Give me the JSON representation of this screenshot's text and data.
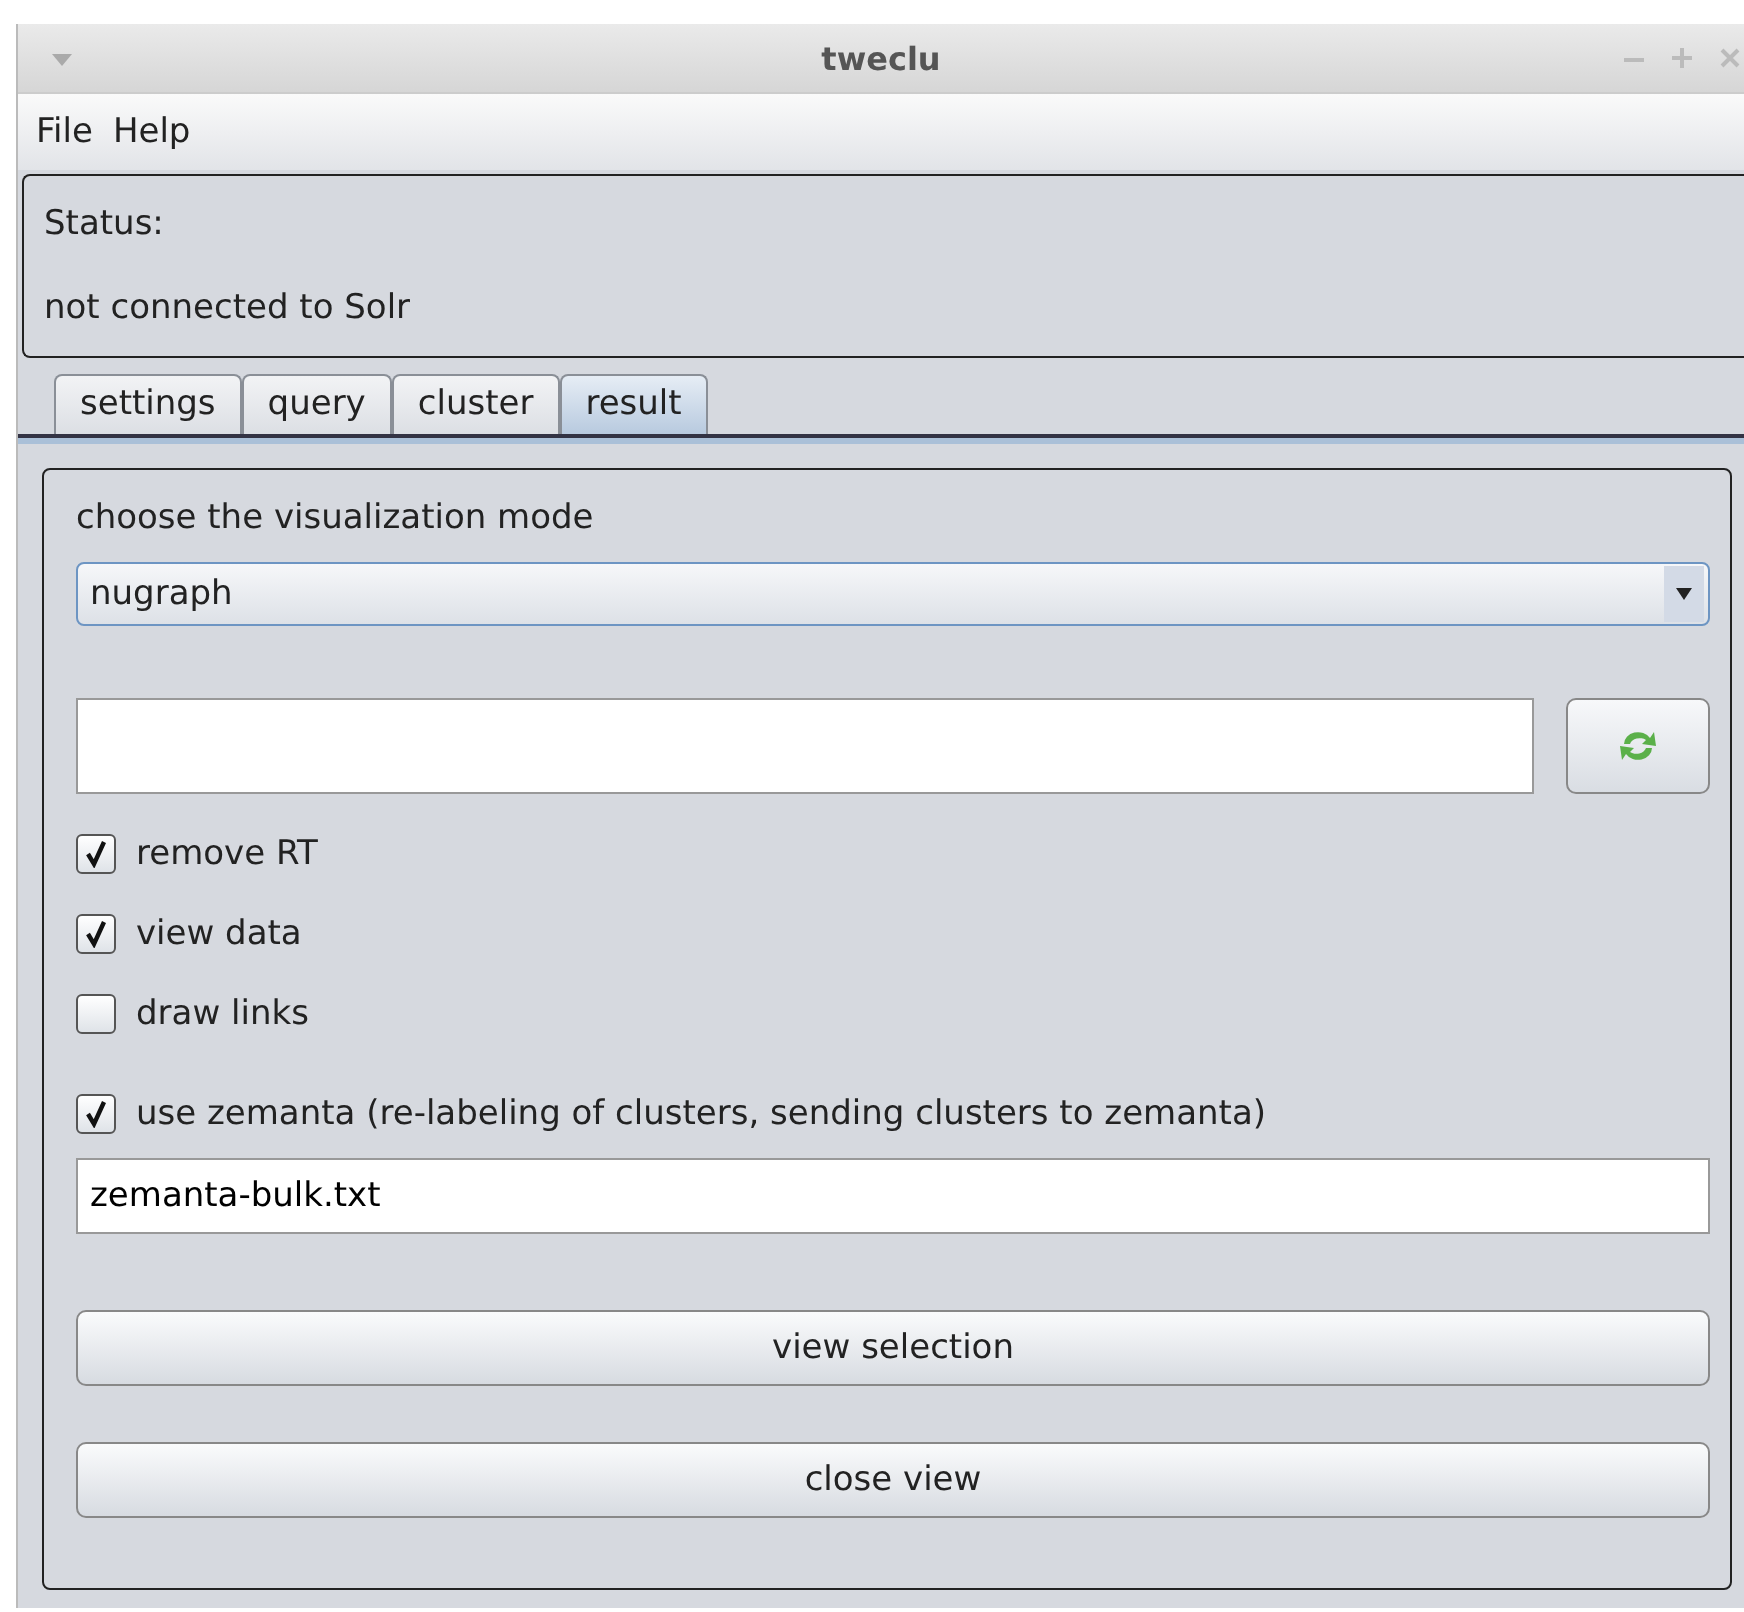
{
  "window": {
    "title": "tweclu"
  },
  "menu": [
    "File",
    "Help"
  ],
  "status": {
    "label": "Status:",
    "message": "not connected to Solr"
  },
  "tabs": [
    {
      "label": "settings",
      "selected": false
    },
    {
      "label": "query",
      "selected": false
    },
    {
      "label": "cluster",
      "selected": false
    },
    {
      "label": "result",
      "selected": true
    }
  ],
  "result": {
    "mode_label": "choose the visualization mode",
    "mode": "nugraph",
    "options": [
      {
        "label": "remove RT",
        "checked": true
      },
      {
        "label": "view data",
        "checked": true
      },
      {
        "label": "draw links",
        "checked": false
      }
    ],
    "zemanta": {
      "label": "use zemanta (re-labeling of clusters, sending clusters to zemanta)",
      "checked": true,
      "file": "zemanta-bulk.txt"
    },
    "buttons": [
      "view selection",
      "close view"
    ]
  }
}
